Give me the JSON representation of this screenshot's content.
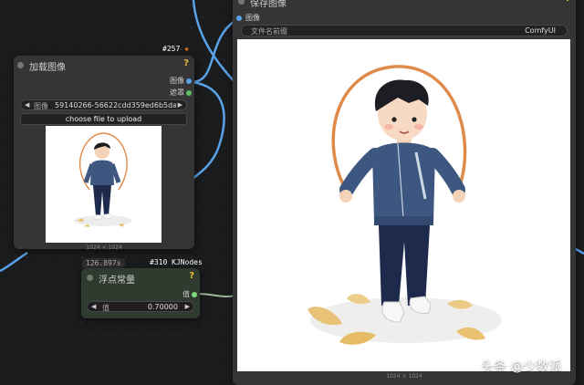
{
  "colors": {
    "canvas": "#1a1b1d",
    "node_bg": "#353535",
    "float_node_bg": "#2f3b2e",
    "wire_image": "#5aa2e8",
    "wire_float": "#9bb59a",
    "help": "#e8b93a",
    "output_image_connector": "#5aa2e8",
    "output_mask_connector": "#5fbf5f",
    "output_float_connector": "#7dd87d"
  },
  "load_image_node": {
    "id_tag": "#257",
    "id_tag_icon": "fox-icon",
    "title": "加载图像",
    "help": "?",
    "outputs": [
      "图像",
      "遮罩"
    ],
    "image_widget": {
      "label": "图像",
      "value": "59140266-56622cdd359ed6b5dad2f..."
    },
    "upload_button": "choose file to upload",
    "caption": "1024 × 1024"
  },
  "save_image_node": {
    "title": "保存图像",
    "help": "?",
    "input": "图像",
    "filename_widget": {
      "label": "文件名前缀",
      "value": "ComfyUI"
    },
    "caption": "1024 × 1024"
  },
  "float_node": {
    "time_badge": "126.897s",
    "id_tag": "#310 KJNodes",
    "title": "浮点常量",
    "help": "?",
    "output": "值",
    "value_widget": {
      "label": "值",
      "value": "0.70000"
    }
  },
  "watermark": "头条 @少数派"
}
